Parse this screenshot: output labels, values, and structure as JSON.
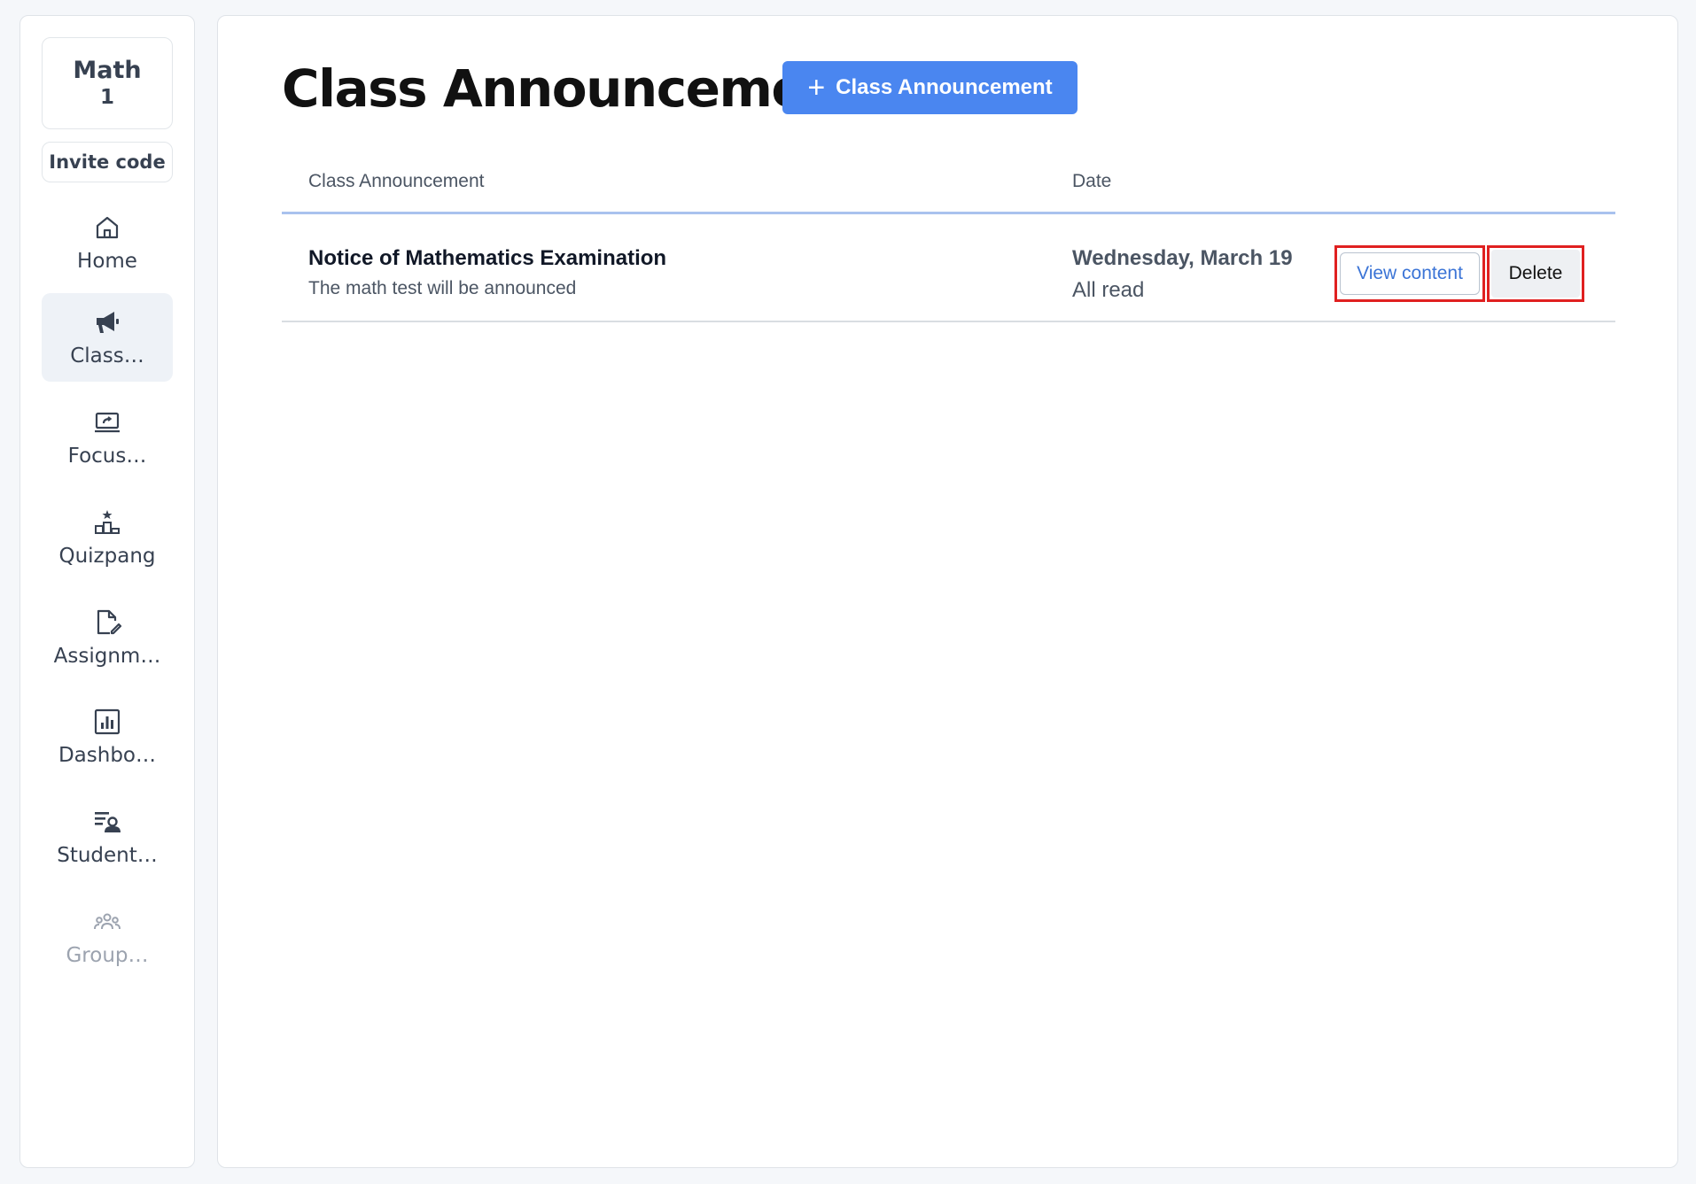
{
  "sidebar": {
    "class_subject": "Math",
    "class_number": "1",
    "invite_label": "Invite code",
    "items": [
      {
        "label": "Home",
        "icon": "home-icon"
      },
      {
        "label": "Class…",
        "icon": "megaphone-icon"
      },
      {
        "label": "Focus…",
        "icon": "screen-share-icon"
      },
      {
        "label": "Quizpang",
        "icon": "podium-icon"
      },
      {
        "label": "Assignm…",
        "icon": "edit-document-icon"
      },
      {
        "label": "Dashbo…",
        "icon": "bar-chart-icon"
      },
      {
        "label": "Student…",
        "icon": "student-list-icon"
      },
      {
        "label": "Group…",
        "icon": "group-icon"
      }
    ]
  },
  "main": {
    "title": "Class Announcement",
    "add_button_label": "Class Announcement",
    "table": {
      "headers": [
        "Class Announcement",
        "Date"
      ],
      "rows": [
        {
          "title": "Notice of Mathematics Examination",
          "description": "The math test will be announced",
          "date": "Wednesday, March 19",
          "status": "All read",
          "view_label": "View content",
          "delete_label": "Delete"
        }
      ]
    }
  },
  "colors": {
    "accent": "#4a86f0",
    "highlight_border": "#e02020",
    "header_rule": "#a9c2ee"
  }
}
